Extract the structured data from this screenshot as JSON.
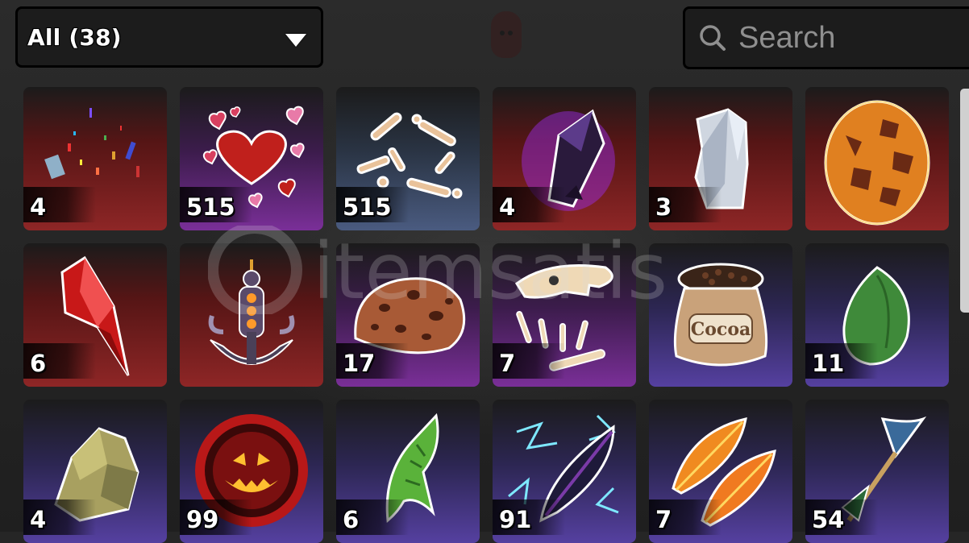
{
  "filter": {
    "label": "All (38)",
    "icon": "chevron-down-icon"
  },
  "search": {
    "placeholder": "Search",
    "value": "",
    "icon": "search-icon"
  },
  "watermark": {
    "text": "itemsatis"
  },
  "items": [
    {
      "name": "confetti",
      "icon": "confetti-icon",
      "count": "4",
      "bg": "red"
    },
    {
      "name": "hearts",
      "icon": "hearts-icon",
      "count": "515",
      "bg": "purple"
    },
    {
      "name": "bones",
      "icon": "bones-icon",
      "count": "515",
      "bg": "blue"
    },
    {
      "name": "dark-crystal",
      "icon": "purple-crystal-icon",
      "count": "4",
      "bg": "red"
    },
    {
      "name": "silver-crystal",
      "icon": "silver-crystal-icon",
      "count": "3",
      "bg": "red"
    },
    {
      "name": "magma-egg",
      "icon": "magma-egg-icon",
      "count": "",
      "bg": "red"
    },
    {
      "name": "red-crystal",
      "icon": "red-crystal-icon",
      "count": "6",
      "bg": "red"
    },
    {
      "name": "anchor-idol",
      "icon": "anchor-idol-icon",
      "count": "",
      "bg": "red"
    },
    {
      "name": "cookie-rock",
      "icon": "cookie-rock-icon",
      "count": "17",
      "bg": "purple"
    },
    {
      "name": "dino-skull",
      "icon": "dino-skull-icon",
      "count": "7",
      "bg": "purple"
    },
    {
      "name": "cocoa-bag",
      "icon": "cocoa-bag-icon",
      "count": "",
      "bg": "indigo",
      "label": "Cocoa"
    },
    {
      "name": "green-egg",
      "icon": "green-egg-icon",
      "count": "11",
      "bg": "indigo"
    },
    {
      "name": "mossy-rock",
      "icon": "mossy-rock-icon",
      "count": "4",
      "bg": "indigo"
    },
    {
      "name": "pumpkin-orb",
      "icon": "pumpkin-orb-icon",
      "count": "99",
      "bg": "indigo"
    },
    {
      "name": "green-fin",
      "icon": "green-fin-icon",
      "count": "6",
      "bg": "indigo"
    },
    {
      "name": "electric-feather",
      "icon": "electric-feather-icon",
      "count": "91",
      "bg": "indigo"
    },
    {
      "name": "fire-feathers",
      "icon": "fire-feathers-icon",
      "count": "7",
      "bg": "indigo"
    },
    {
      "name": "fish-tail-arrow",
      "icon": "fish-tail-arrow-icon",
      "count": "54",
      "bg": "indigo"
    }
  ]
}
